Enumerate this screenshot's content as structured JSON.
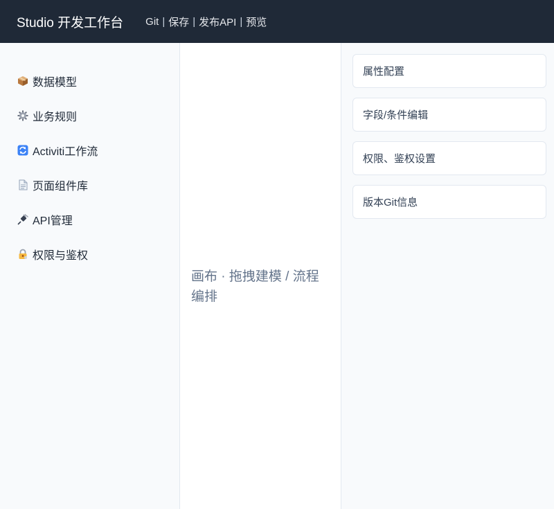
{
  "header": {
    "title": "Studio 开发工作台",
    "actions": [
      "Git",
      "保存",
      "发布API",
      "预览"
    ],
    "separator": "|"
  },
  "sidebar": {
    "items": [
      {
        "icon": "package-icon",
        "label": "数据模型"
      },
      {
        "icon": "gear-icon",
        "label": "业务规则"
      },
      {
        "icon": "refresh-icon",
        "label": "Activiti工作流"
      },
      {
        "icon": "page-icon",
        "label": "页面组件库"
      },
      {
        "icon": "plug-icon",
        "label": "API管理"
      },
      {
        "icon": "lock-icon",
        "label": "权限与鉴权"
      }
    ]
  },
  "canvas": {
    "label": "画布 · 拖拽建模 / 流程编排"
  },
  "properties": {
    "cards": [
      "属性配置",
      "字段/条件编辑",
      "权限、鉴权设置",
      "版本Git信息"
    ]
  },
  "colors": {
    "topbar": "#1f2937",
    "background": "#f8fafc",
    "canvas": "#ffffff",
    "border": "#e2e8f0"
  }
}
